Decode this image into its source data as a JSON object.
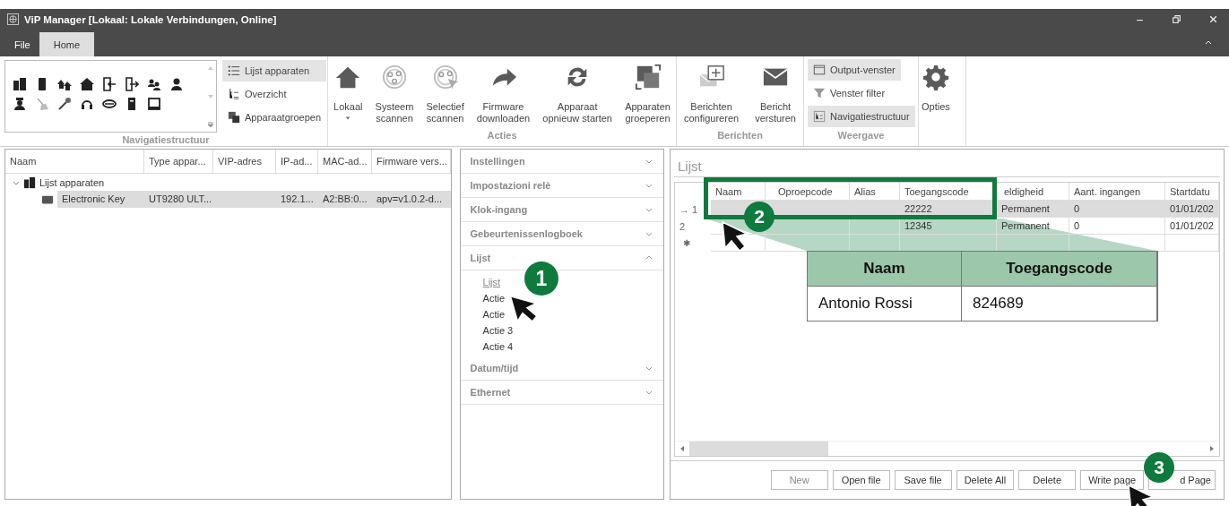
{
  "window": {
    "title": "ViP Manager [Lokaal: Lokale Verbindungen, Online]"
  },
  "menu_tabs": [
    {
      "label": "File",
      "selected": false
    },
    {
      "label": "Home",
      "selected": true
    }
  ],
  "ribbon": {
    "navigation": {
      "label": "Navigatiestructuur",
      "views": [
        {
          "label": "Lijst apparaten",
          "selected": true
        },
        {
          "label": "Overzicht",
          "selected": false
        },
        {
          "label": "Apparaatgroepen",
          "selected": false
        }
      ]
    },
    "actions": {
      "label": "Acties",
      "buttons": [
        {
          "label": "Lokaal",
          "dropdown": true
        },
        {
          "label": "Systeem\nscannen",
          "dropdown": false
        },
        {
          "label": "Selectief\nscannen",
          "dropdown": false
        },
        {
          "label": "Firmware\ndownloaden",
          "dropdown": false
        },
        {
          "label": "Apparaat\nopnieuw starten",
          "dropdown": false
        },
        {
          "label": "Apparaten\ngroeperen",
          "dropdown": false
        }
      ]
    },
    "messages": {
      "label": "Berichten",
      "buttons": [
        {
          "label": "Berichten\nconfigureren"
        },
        {
          "label": "Bericht\nversturen"
        }
      ]
    },
    "view": {
      "label": "Weergave",
      "toggles": [
        {
          "label": "Output-venster",
          "selected": true
        },
        {
          "label": "Venster filter",
          "selected": false
        },
        {
          "label": "Navigatiestructuur",
          "selected": true
        }
      ]
    },
    "options": {
      "label": "Opties"
    }
  },
  "device_tree": {
    "columns": [
      "Naam",
      "Type appar...",
      "VIP-adres",
      "IP-ad...",
      "MAC-ad...",
      "Firmware vers..."
    ],
    "root": {
      "name": "Lijst apparaten",
      "expanded": true,
      "children": [
        {
          "name": "Electronic Key",
          "type": "UT9280 ULT...",
          "ip": "192.1...",
          "mac": "A2:BB:0...",
          "firmware": "apv=v1.0.2-d...",
          "selected": true
        }
      ]
    }
  },
  "settings_sections": [
    {
      "title": "Instellingen",
      "expanded": false
    },
    {
      "title": "Impostazioni relè",
      "expanded": false
    },
    {
      "title": "Klok-ingang",
      "expanded": false
    },
    {
      "title": "Gebeurtenissenlogboek",
      "expanded": false
    },
    {
      "title": "Lijst",
      "expanded": true,
      "items": [
        {
          "label": "Lijst",
          "selected": true
        },
        {
          "label": "Actie",
          "selected": false
        },
        {
          "label": "Actie",
          "selected": false
        },
        {
          "label": "Actie 3",
          "selected": false
        },
        {
          "label": "Actie 4",
          "selected": false
        }
      ]
    },
    {
      "title": "Datum/tijd",
      "expanded": false
    },
    {
      "title": "Ethernet",
      "expanded": false
    }
  ],
  "list_panel": {
    "title": "Lijst",
    "columns": [
      "Naam",
      "Oproepcode",
      "Alias",
      "Toegangscode",
      "eldigheid",
      "Aant. ingangen",
      "Startdatu"
    ],
    "rows": [
      {
        "indicator": "→",
        "number": "1",
        "selected": true,
        "code": "22222",
        "validity": "Permanent",
        "inputs": "0",
        "start": "01/01/202"
      },
      {
        "number": "2",
        "selected": false,
        "code": "12345",
        "validity": "Permanent",
        "inputs": "0",
        "start": "01/01/202"
      }
    ],
    "new_row": {
      "mark": "✱"
    },
    "buttons": [
      {
        "label": "New",
        "disabled": true
      },
      {
        "label": "Open file",
        "disabled": false
      },
      {
        "label": "Save file",
        "disabled": false
      },
      {
        "label": "Delete All",
        "disabled": false
      },
      {
        "label": "Delete",
        "disabled": false
      },
      {
        "label": "Write page",
        "disabled": false
      },
      {
        "label": "d Page",
        "disabled": false
      }
    ]
  },
  "callouts": [
    {
      "number": "1"
    },
    {
      "number": "2"
    },
    {
      "number": "3"
    }
  ],
  "zoom_table": {
    "columns": [
      "Naam",
      "Toegangscode"
    ],
    "rows": [
      [
        "Antonio Rossi",
        "824689"
      ]
    ]
  }
}
